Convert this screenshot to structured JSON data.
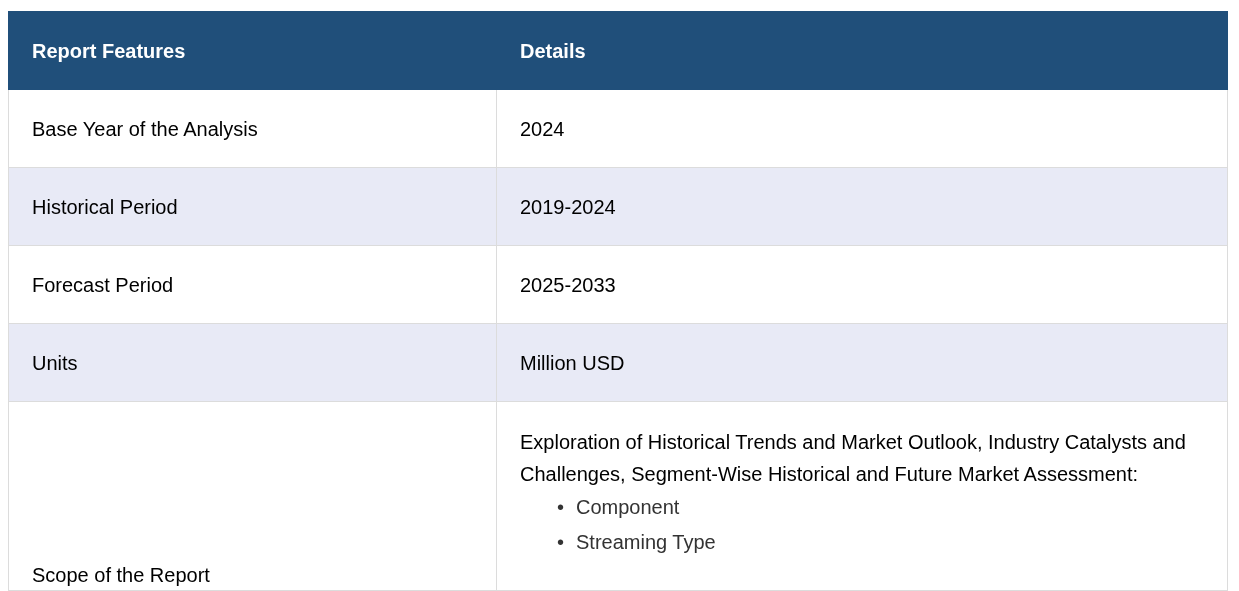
{
  "table": {
    "columns": [
      "Report Features",
      "Details"
    ],
    "rows": [
      {
        "feature": "Base Year of the Analysis",
        "detail": "2024"
      },
      {
        "feature": "Historical Period",
        "detail": "2019-2024"
      },
      {
        "feature": "Forecast Period",
        "detail": "2025-2033"
      },
      {
        "feature": "Units",
        "detail": "Million USD"
      },
      {
        "feature": "Scope of the Report",
        "detail": "Exploration of Historical Trends and Market Outlook, Industry Catalysts and Challenges, Segment-Wise Historical and Future Market Assessment:",
        "list": [
          {
            "marker": "•",
            "text": "Component"
          },
          {
            "marker": "•",
            "text": "Streaming Type"
          }
        ]
      }
    ]
  }
}
